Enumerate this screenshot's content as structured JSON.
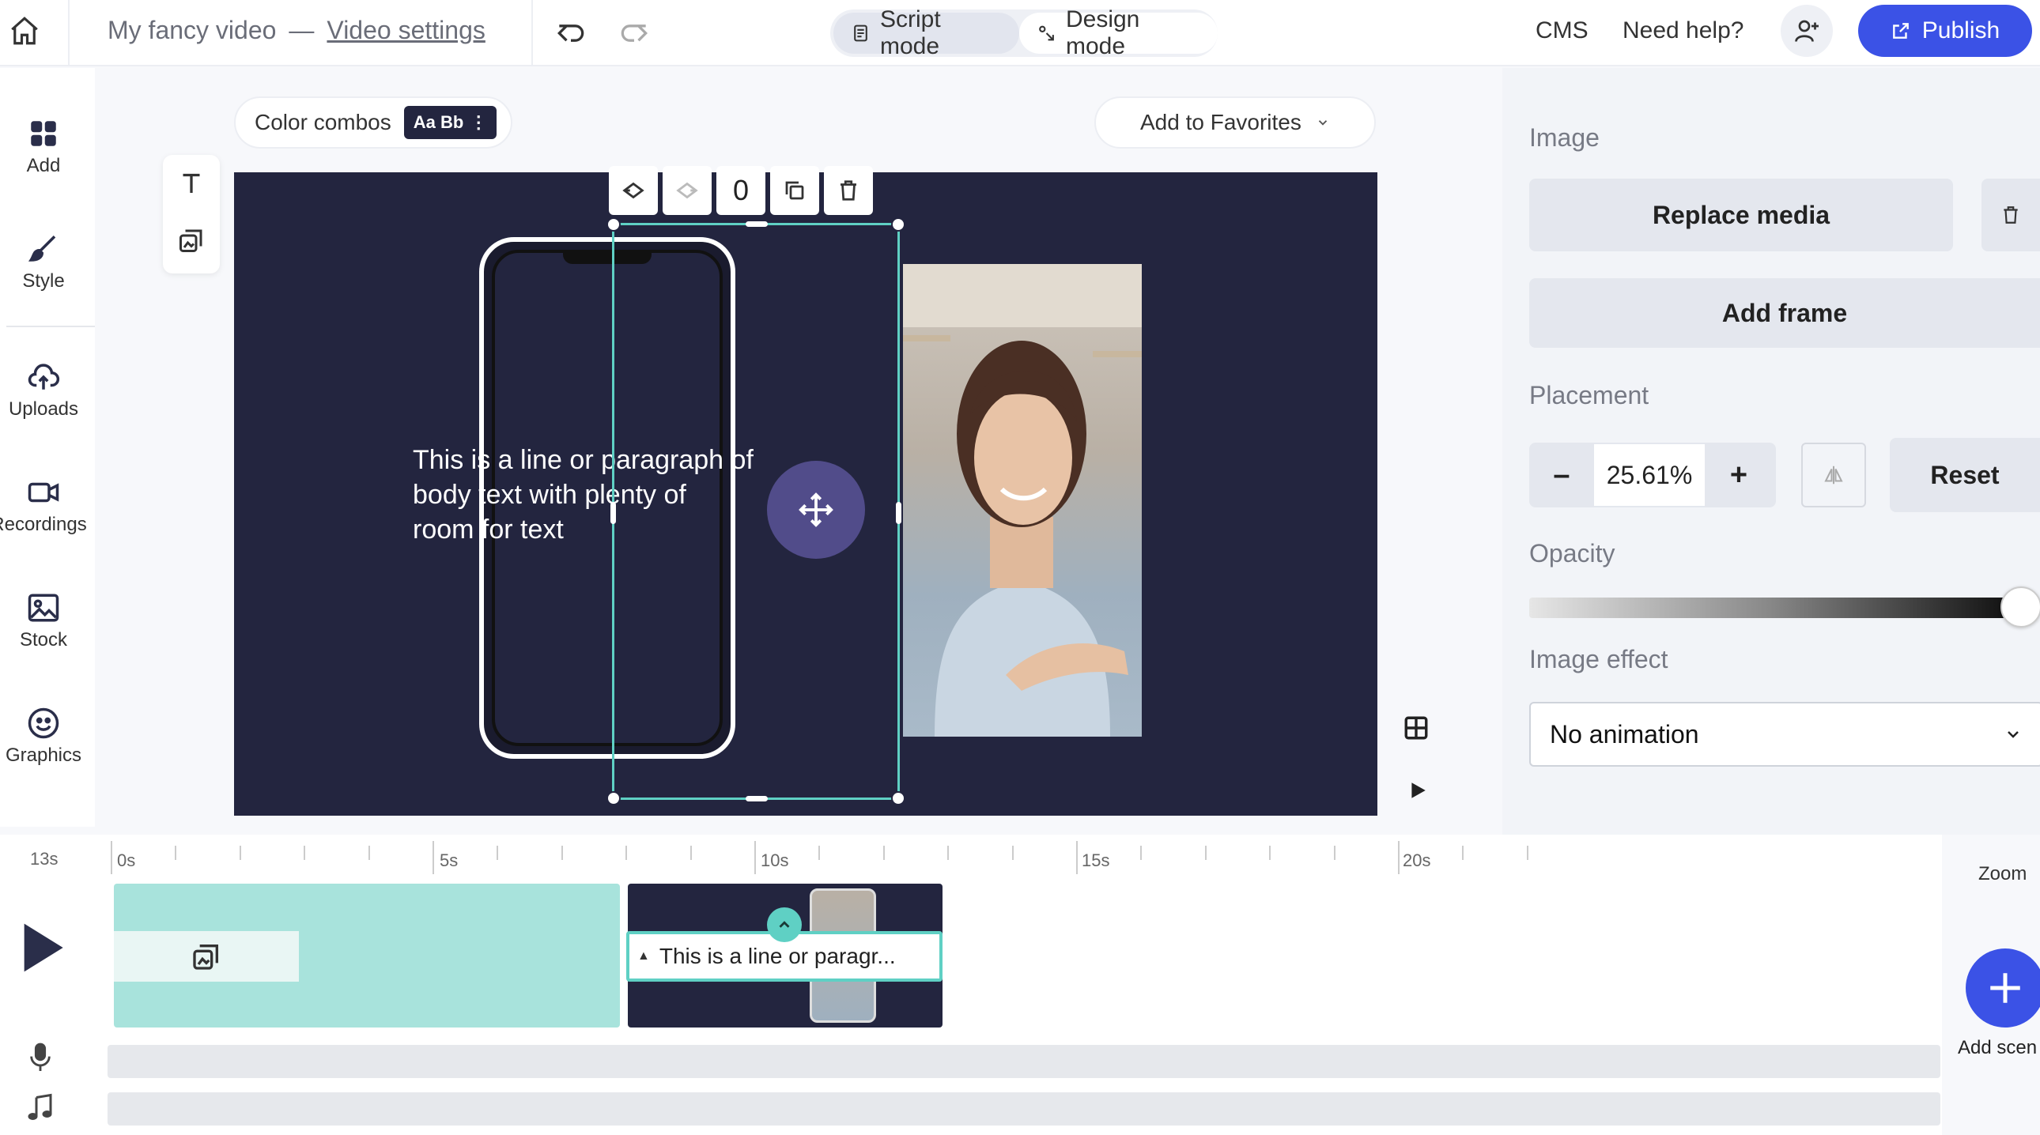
{
  "header": {
    "project_name": "My fancy video",
    "separator": "—",
    "video_settings_link": "Video settings",
    "script_mode_label": "Script mode",
    "design_mode_label": "Design mode",
    "cms_label": "CMS",
    "help_label": "Need help?",
    "publish_label": "Publish"
  },
  "sidebar": {
    "items": [
      {
        "label": "Add",
        "icon": "grid-icon"
      },
      {
        "label": "Style",
        "icon": "brush-icon"
      },
      {
        "label": "Uploads",
        "icon": "cloud-upload-icon"
      },
      {
        "label": "Recordings",
        "icon": "video-camera-icon"
      },
      {
        "label": "Stock",
        "icon": "image-icon"
      },
      {
        "label": "Graphics",
        "icon": "smiley-icon"
      }
    ]
  },
  "canvas": {
    "color_combos_label": "Color combos",
    "color_combos_badge": "Aa Bb",
    "favorites_label": "Add to Favorites",
    "layer_index": "0",
    "body_text_lines": [
      "This is a line or paragraph of",
      "body text with plenty of",
      "room for text"
    ]
  },
  "panel": {
    "image_label": "Image",
    "replace_media_label": "Replace media",
    "add_frame_label": "Add frame",
    "placement_label": "Placement",
    "zoom_value": "25.61%",
    "minus_label": "–",
    "plus_label": "+",
    "reset_label": "Reset",
    "opacity_label": "Opacity",
    "opacity_value": 1.0,
    "image_effect_label": "Image effect",
    "image_effect_value": "No animation"
  },
  "timeline": {
    "duration": "13s",
    "ticks": [
      "0s",
      "5s",
      "10s",
      "15s",
      "20s"
    ],
    "clip_text": "This is a line or paragr...",
    "zoom_label": "Zoom",
    "add_scene_label": "Add scen"
  },
  "colors": {
    "accent": "#3b52e6",
    "stage_bg": "#23253f",
    "selection": "#5fd0c4",
    "scene1": "#a8e3dc"
  }
}
